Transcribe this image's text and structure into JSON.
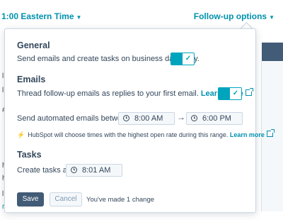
{
  "header": {
    "timezone_label": "1:00 Eastern Time",
    "followup_label": "Follow-up options",
    "caret": "▼"
  },
  "background": {
    "left_marks": [
      "l",
      "l",
      "#",
      "h",
      "h",
      "l",
      "r"
    ]
  },
  "popover": {
    "general": {
      "title": "General",
      "business_days_text": "Send emails and create tasks on business days only.",
      "business_days_enabled": true
    },
    "emails": {
      "title": "Emails",
      "thread_text": "Thread follow-up emails as replies to your first email.",
      "learn_more": "Learn more",
      "thread_enabled": true,
      "send_between_label": "Send automated emails between",
      "start_time": "8:00 AM",
      "end_time": "6:00 PM",
      "range_arrow": "→",
      "hint_text": "HubSpot will choose times with the highest open rate during this range.",
      "hint_learn_more": "Learn more",
      "bolt": "⚡"
    },
    "tasks": {
      "title": "Tasks",
      "create_label": "Create tasks at",
      "task_time": "8:01 AM"
    },
    "footer": {
      "save_label": "Save",
      "cancel_label": "Cancel",
      "change_note": "You've made 1 change"
    }
  },
  "colors": {
    "accent": "#0091ae",
    "toggle": "#00a4bd",
    "save_button": "#425b76",
    "text": "#33475b",
    "border": "#cbd6e2"
  }
}
